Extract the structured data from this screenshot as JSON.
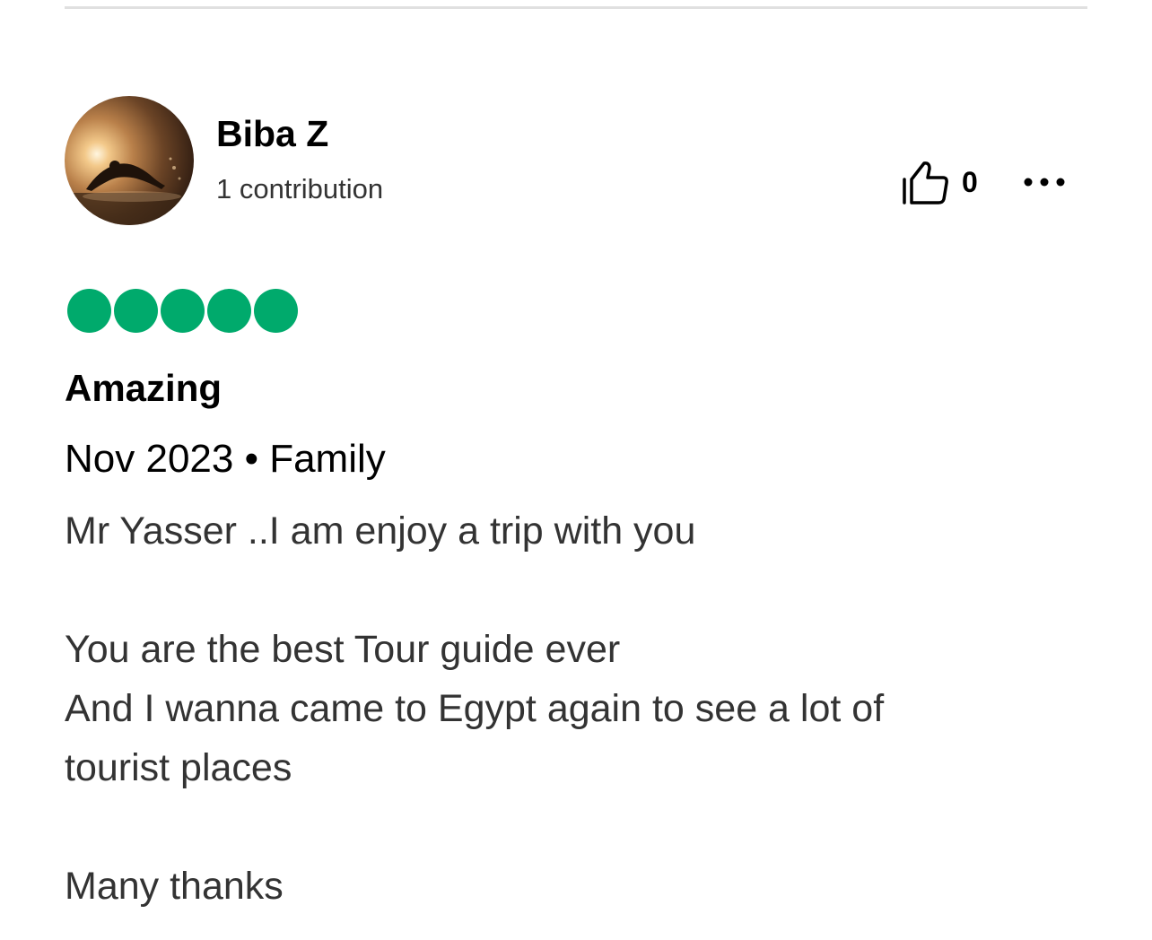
{
  "review": {
    "author": {
      "name": "Biba Z",
      "contributions": "1 contribution",
      "avatar": "avatar-swimmer-sunset-photo"
    },
    "helpful": {
      "icon": "thumbs-up-icon",
      "count": "0"
    },
    "more_icon": "more-options-icon",
    "rating": {
      "value": 5,
      "max": 5,
      "color": "#00aa6c"
    },
    "title": "Amazing",
    "meta": "Nov 2023 • Family",
    "body": {
      "line1": "Mr Yasser ..I am enjoy a trip with you",
      "line2": "You are the best Tour guide ever",
      "line3": "And I wanna came to Egypt again to see a lot of",
      "line4": "tourist places",
      "line5": "Many thanks"
    }
  }
}
